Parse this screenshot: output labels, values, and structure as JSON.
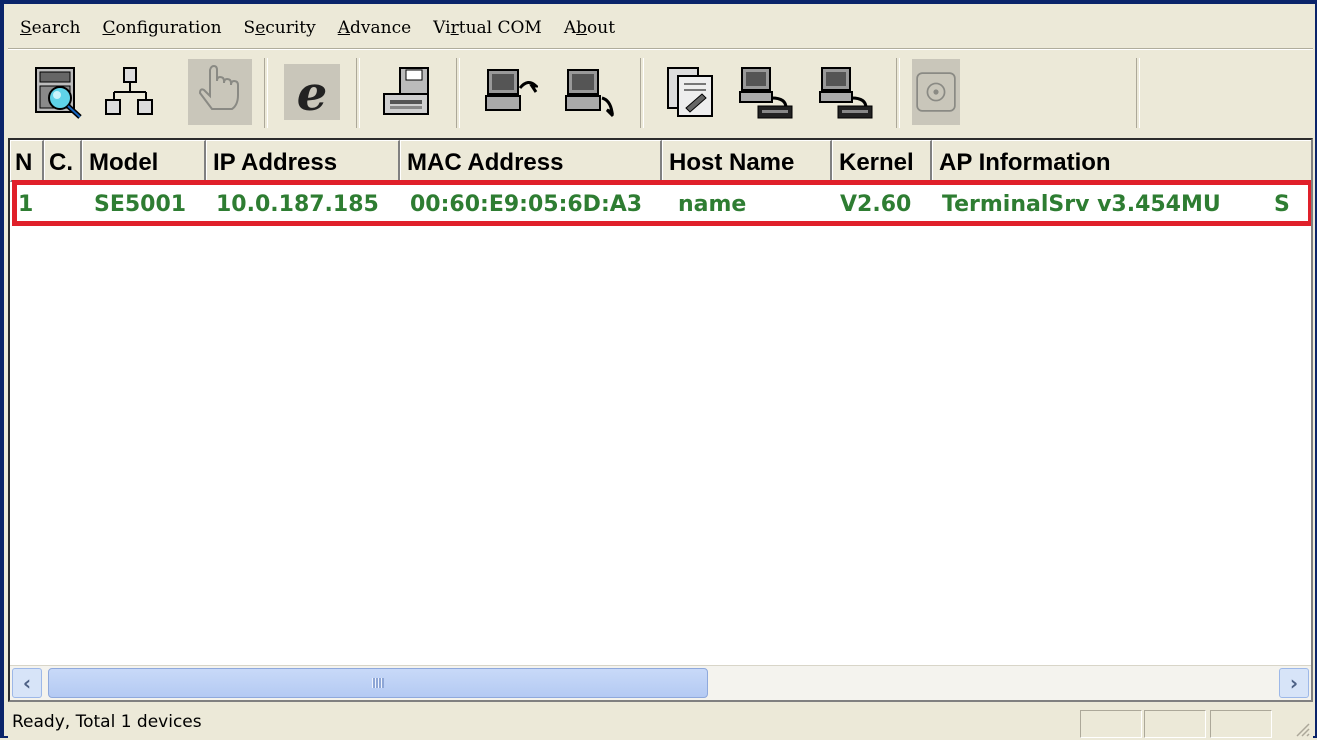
{
  "menu": {
    "items": [
      {
        "label": "Search",
        "accel": "S"
      },
      {
        "label": "Configuration",
        "accel": "C"
      },
      {
        "label": "Security",
        "accel": "e"
      },
      {
        "label": "Advance",
        "accel": "A"
      },
      {
        "label": "Virtual COM",
        "accel": "r"
      },
      {
        "label": "About",
        "accel": "b"
      }
    ]
  },
  "toolbar": {
    "buttons": [
      {
        "name": "search-icon",
        "enabled": true
      },
      {
        "name": "network-tree-icon",
        "enabled": true
      },
      {
        "name": "hand-icon",
        "enabled": false
      },
      {
        "name": "internet-explorer-icon",
        "enabled": true
      },
      {
        "name": "save-disk-icon",
        "enabled": true
      },
      {
        "name": "computer-upload-icon",
        "enabled": true
      },
      {
        "name": "computer-download-icon",
        "enabled": true
      },
      {
        "name": "settings-document-icon",
        "enabled": true
      },
      {
        "name": "computer-serial-icon",
        "enabled": true
      },
      {
        "name": "computer-serial-alt-icon",
        "enabled": true
      },
      {
        "name": "phone-icon",
        "enabled": false
      }
    ]
  },
  "table": {
    "columns": [
      "N",
      "C.",
      "Model",
      "IP Address",
      "MAC Address",
      "Host Name",
      "Kernel",
      "AP Information"
    ],
    "rows": [
      {
        "cells": [
          "1",
          "",
          "SE5001",
          "10.0.187.185",
          "00:60:E9:05:6D:A3",
          "name",
          "V2.60",
          "TerminalSrv v3.454MU",
          "S"
        ]
      }
    ]
  },
  "colors": {
    "row_text": "#2e7d32",
    "highlight_border": "#e0202a",
    "window_border": "#0a246a"
  },
  "status": {
    "text": "Ready, Total 1 devices"
  }
}
